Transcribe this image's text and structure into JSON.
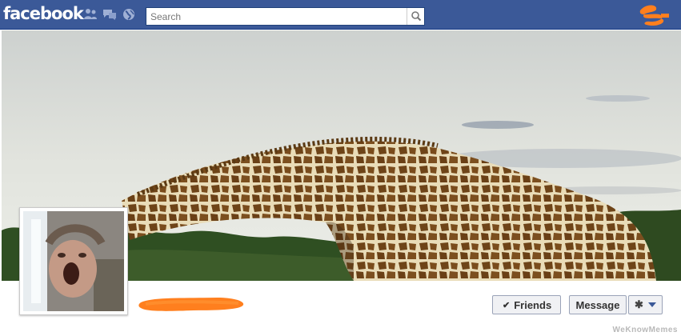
{
  "topbar": {
    "logo": "facebook",
    "jewels": [
      "friend-requests-icon",
      "messages-icon",
      "notifications-icon"
    ],
    "search": {
      "placeholder": "Search"
    }
  },
  "profile": {
    "actions": {
      "friends_label": "Friends",
      "message_label": "Message"
    }
  },
  "watermark": "WeKnowMemes",
  "colors": {
    "topbar": "#3b5998",
    "scribble": "#ff7f1e",
    "button_bg": "#f0f1f4"
  }
}
